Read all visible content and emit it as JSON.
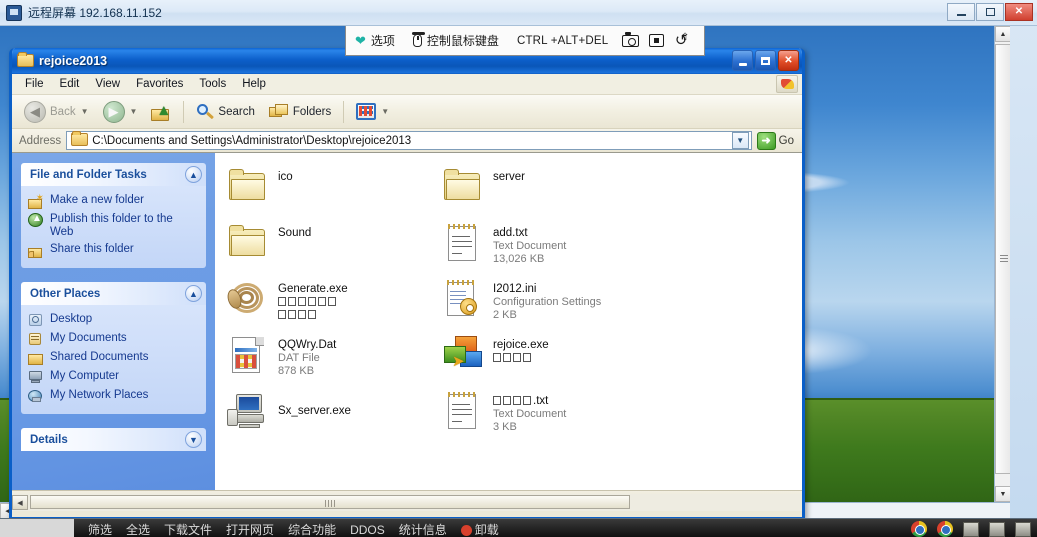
{
  "outer_window": {
    "title": "远程屏幕 192.168.11.152",
    "icon": "remote-screen-icon",
    "minimize_label": "",
    "maximize_label": "",
    "close_label": "✕"
  },
  "remote_toolbar": {
    "options_label": "选项",
    "options_icon": "heart-icon",
    "control_label": "控制鼠标键盘",
    "control_icon": "mouse-icon",
    "cad_label": "CTRL +ALT+DEL",
    "screenshot_icon": "camera-icon",
    "fullscreen_icon": "expand-icon",
    "sync_icon": "refresh-icon"
  },
  "explorer": {
    "title": "rejoice2013",
    "title_icon": "folder-icon",
    "window_buttons": {
      "minimize": "",
      "maximize": "",
      "close": "✕"
    },
    "menus": [
      "File",
      "Edit",
      "View",
      "Favorites",
      "Tools",
      "Help"
    ],
    "toolbar": {
      "back_label": "Back",
      "forward_label": "",
      "up_label": "",
      "search_label": "Search",
      "folders_label": "Folders",
      "views_label": ""
    },
    "address": {
      "label": "Address",
      "value": "C:\\Documents and Settings\\Administrator\\Desktop\\rejoice2013",
      "go_label": "Go"
    },
    "sidebar": {
      "panels": [
        {
          "title": "File and Folder Tasks",
          "collapse_icon": "chevron-up-icon",
          "links": [
            {
              "label": "Make a new folder",
              "icon": "new-folder-icon"
            },
            {
              "label": "Publish this folder to the Web",
              "icon": "publish-web-icon"
            },
            {
              "label": "Share this folder",
              "icon": "share-folder-icon"
            }
          ]
        },
        {
          "title": "Other Places",
          "collapse_icon": "chevron-up-icon",
          "links": [
            {
              "label": "Desktop",
              "icon": "desktop-icon"
            },
            {
              "label": "My Documents",
              "icon": "my-documents-icon"
            },
            {
              "label": "Shared Documents",
              "icon": "shared-documents-icon"
            },
            {
              "label": "My Computer",
              "icon": "my-computer-icon"
            },
            {
              "label": "My Network Places",
              "icon": "network-places-icon"
            }
          ]
        },
        {
          "title": "Details",
          "collapse_icon": "chevron-down-icon",
          "links": []
        }
      ]
    },
    "files": [
      {
        "name": "ico",
        "type": "",
        "size": "",
        "icon": "folder-icon",
        "tofu": 0,
        "tofu2": 0
      },
      {
        "name": "server",
        "type": "",
        "size": "",
        "icon": "folder-icon",
        "tofu": 0,
        "tofu2": 0
      },
      {
        "name": "Sound",
        "type": "",
        "size": "",
        "icon": "folder-icon",
        "tofu": 0,
        "tofu2": 0
      },
      {
        "name": "add.txt",
        "type": "Text Document",
        "size": "13,026 KB",
        "icon": "text-document-icon",
        "tofu": 0,
        "tofu2": 0
      },
      {
        "name": "Generate.exe",
        "type": "",
        "size": "",
        "icon": "coil-application-icon",
        "tofu": 6,
        "tofu2": 4
      },
      {
        "name": "I2012.ini",
        "type": "Configuration Settings",
        "size": "2 KB",
        "icon": "configuration-settings-icon",
        "tofu": 0,
        "tofu2": 0
      },
      {
        "name": "QQWry.Dat",
        "type": "DAT File",
        "size": "878 KB",
        "icon": "dat-file-icon",
        "tofu": 0,
        "tofu2": 0
      },
      {
        "name": "rejoice.exe",
        "type": "",
        "size": "",
        "icon": "rejoice-application-icon",
        "tofu": 4,
        "tofu2": 0
      },
      {
        "name": "Sx_server.exe",
        "type": "",
        "size": "",
        "icon": "server-application-icon",
        "tofu": 0,
        "tofu2": 0
      },
      {
        "name": ".txt",
        "type": "Text Document",
        "size": "3 KB",
        "icon": "text-document-icon",
        "tofu_prefix": 4,
        "tofu": 0,
        "tofu2": 0
      }
    ],
    "status_bar": {
      "text": ""
    }
  },
  "host_taskbar": {
    "items": [
      "筛选",
      "全选",
      "下载文件",
      "打开网页",
      "综合功能",
      "DDOS",
      "统计信息"
    ],
    "alert_label": "卸载",
    "alert_icon": "stop-icon",
    "tray_icons": [
      "chrome-icon",
      "chrome-icon",
      "app-icon",
      "app-icon",
      "app-icon"
    ]
  },
  "scrollbars": {
    "up_arrow": "▲",
    "down_arrow": "▼",
    "left_arrow": "◀",
    "right_arrow": "▶"
  },
  "colors": {
    "xp_blue": "#0a5fc8",
    "xp_sidebar": "#6e9de4",
    "accent_green": "#3c9a22",
    "close_red": "#e14e28",
    "teal_heart": "#1fb3a6"
  }
}
